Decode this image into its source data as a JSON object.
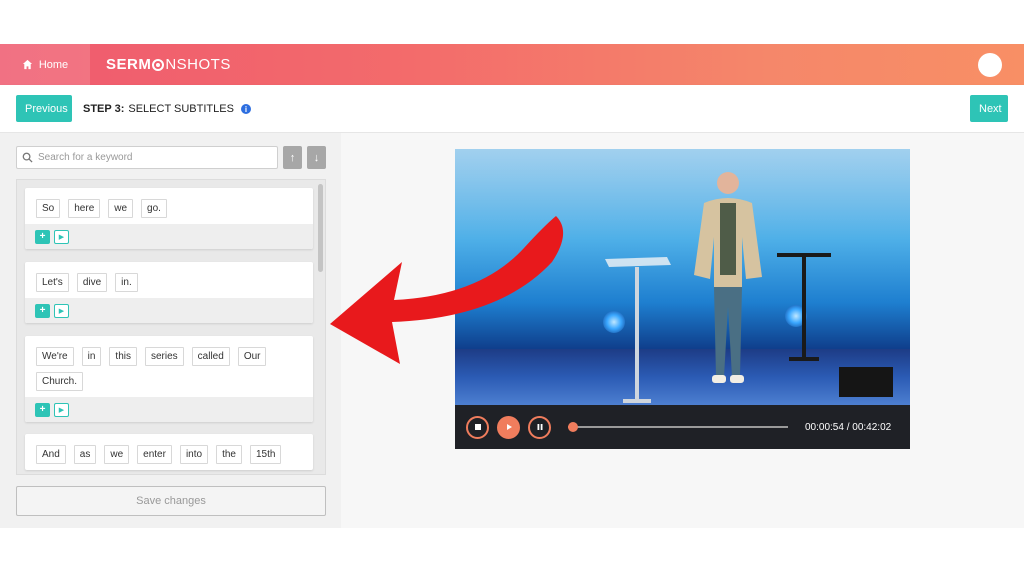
{
  "topbar": {
    "home_label": "Home",
    "logo_left": "SERM",
    "logo_right": "NSHOTS",
    "brand_gradient": [
      "#ef5a6f",
      "#f88f65"
    ]
  },
  "stepbar": {
    "previous_label": "Previous",
    "step_prefix": "STEP 3:",
    "step_title": "SELECT SUBTITLES",
    "info_icon": "i",
    "next_label": "Next",
    "accent": "#2ec4b6"
  },
  "search": {
    "placeholder": "Search for a keyword",
    "up_arrow": "↑",
    "down_arrow": "↓"
  },
  "subtitles": [
    {
      "words": [
        "So",
        "here",
        "we",
        "go."
      ]
    },
    {
      "words": [
        "Let's",
        "dive",
        "in."
      ]
    },
    {
      "words": [
        "We're",
        "in",
        "this",
        "series",
        "called",
        "Our",
        "Church."
      ]
    },
    {
      "words": [
        "And",
        "as",
        "we",
        "enter",
        "into",
        "the",
        "15th"
      ]
    }
  ],
  "card_actions": {
    "add": "+",
    "play": "▶"
  },
  "save_label": "Save changes",
  "player": {
    "current_time": "00:00:54",
    "total_time": "00:42:02",
    "progress_fraction": 0.021,
    "accent": "#f07d5d"
  }
}
